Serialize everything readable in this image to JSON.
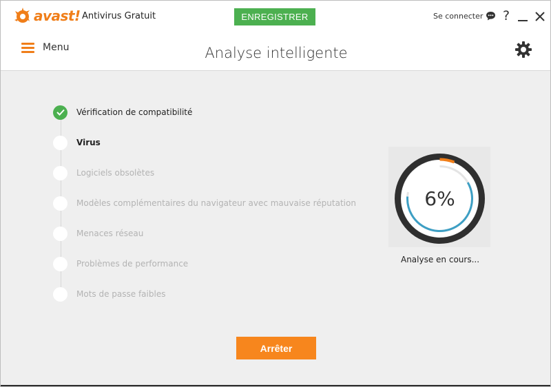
{
  "header": {
    "logo_text": "avast!",
    "product_name": "Antivirus Gratuit",
    "register_label": "ENREGISTRER",
    "connect_label": "Se connecter",
    "help_label": "?"
  },
  "toolbar": {
    "menu_label": "Menu",
    "page_title": "Analyse intelligente"
  },
  "steps": [
    {
      "label": "Vérification de compatibilité",
      "state": "done"
    },
    {
      "label": "Virus",
      "state": "active"
    },
    {
      "label": "Logiciels obsolètes",
      "state": "pending"
    },
    {
      "label": "Modèles complémentaires du navigateur avec mauvaise réputation",
      "state": "pending"
    },
    {
      "label": "Menaces réseau",
      "state": "pending"
    },
    {
      "label": "Problèmes de performance",
      "state": "pending"
    },
    {
      "label": "Mots de passe faibles",
      "state": "pending"
    }
  ],
  "progress": {
    "percent_text": "6%",
    "fraction": 0.06,
    "status_text": "Analyse en cours..."
  },
  "actions": {
    "stop_label": "Arrêter"
  },
  "colors": {
    "accent": "#f07e19",
    "success": "#4cb050",
    "progress_ring": "#3d9fc4"
  },
  "icons": {
    "chat": "chat-bubble-icon",
    "gear": "gear-icon",
    "close": "close-icon"
  }
}
